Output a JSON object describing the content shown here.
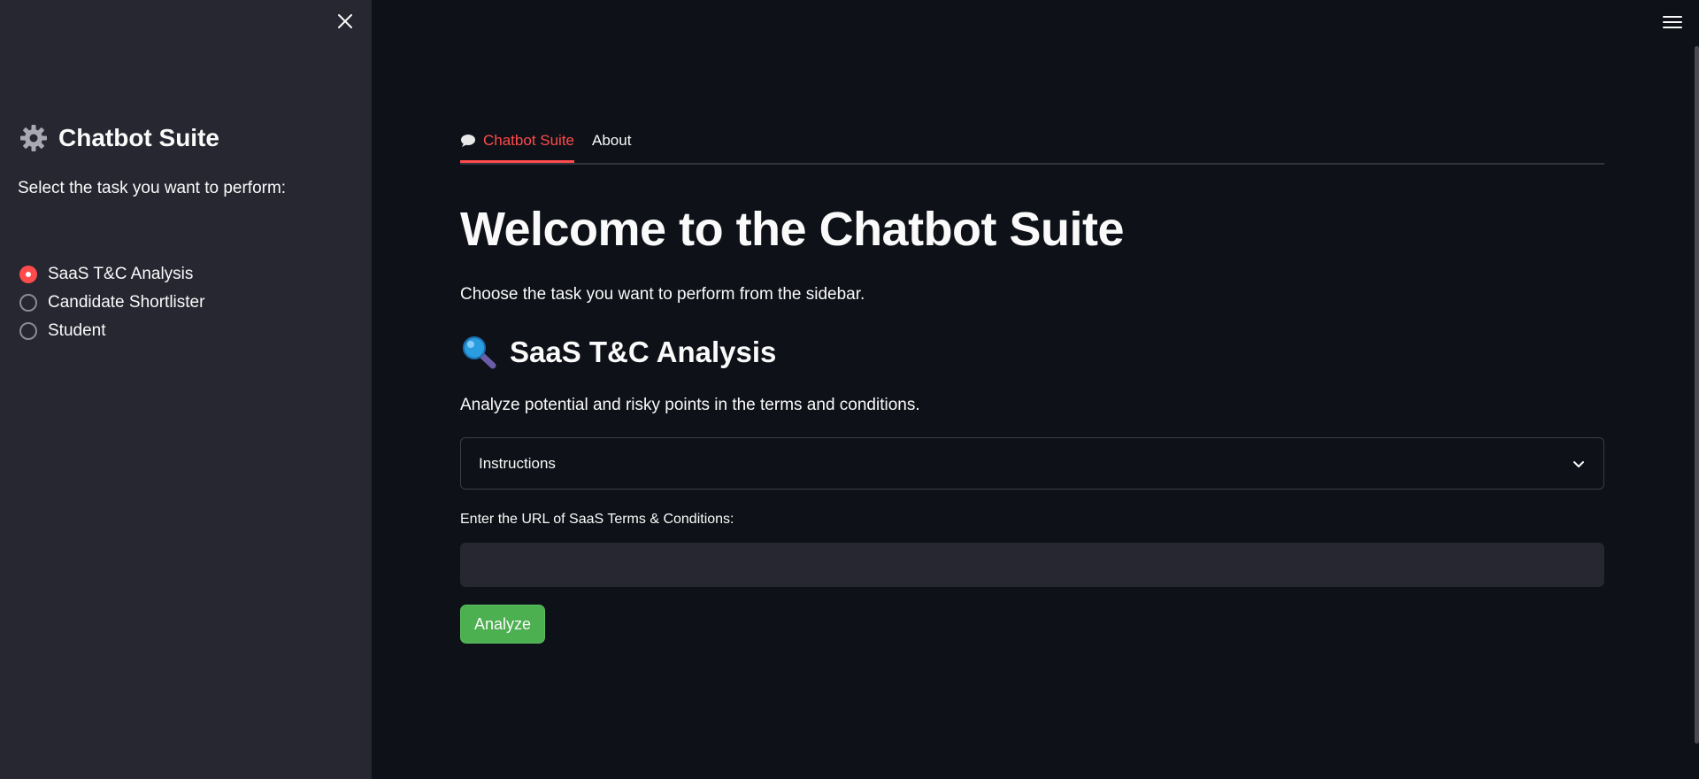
{
  "sidebar": {
    "title": "Chatbot Suite",
    "title_icon": "gear-icon",
    "prompt": "Select the task you want to perform:",
    "options": [
      {
        "label": "SaaS T&C Analysis",
        "selected": true
      },
      {
        "label": "Candidate Shortlister",
        "selected": false
      },
      {
        "label": "Student",
        "selected": false
      }
    ]
  },
  "tabs": [
    {
      "label": "Chatbot Suite",
      "icon": "speech-bubble-icon",
      "active": true
    },
    {
      "label": "About",
      "active": false
    }
  ],
  "main": {
    "title": "Welcome to the Chatbot Suite",
    "intro": "Choose the task you want to perform from the sidebar.",
    "section_title": "SaaS T&C Analysis",
    "section_icon": "magnifier-icon",
    "section_desc": "Analyze potential and risky points in the terms and conditions.",
    "expander_label": "Instructions",
    "url_label": "Enter the URL of SaaS Terms & Conditions:",
    "url_value": "",
    "button_label": "Analyze"
  },
  "colors": {
    "background": "#0e1117",
    "sidebar": "#262730",
    "accent": "#ff4b4b",
    "button": "#4caf50"
  }
}
